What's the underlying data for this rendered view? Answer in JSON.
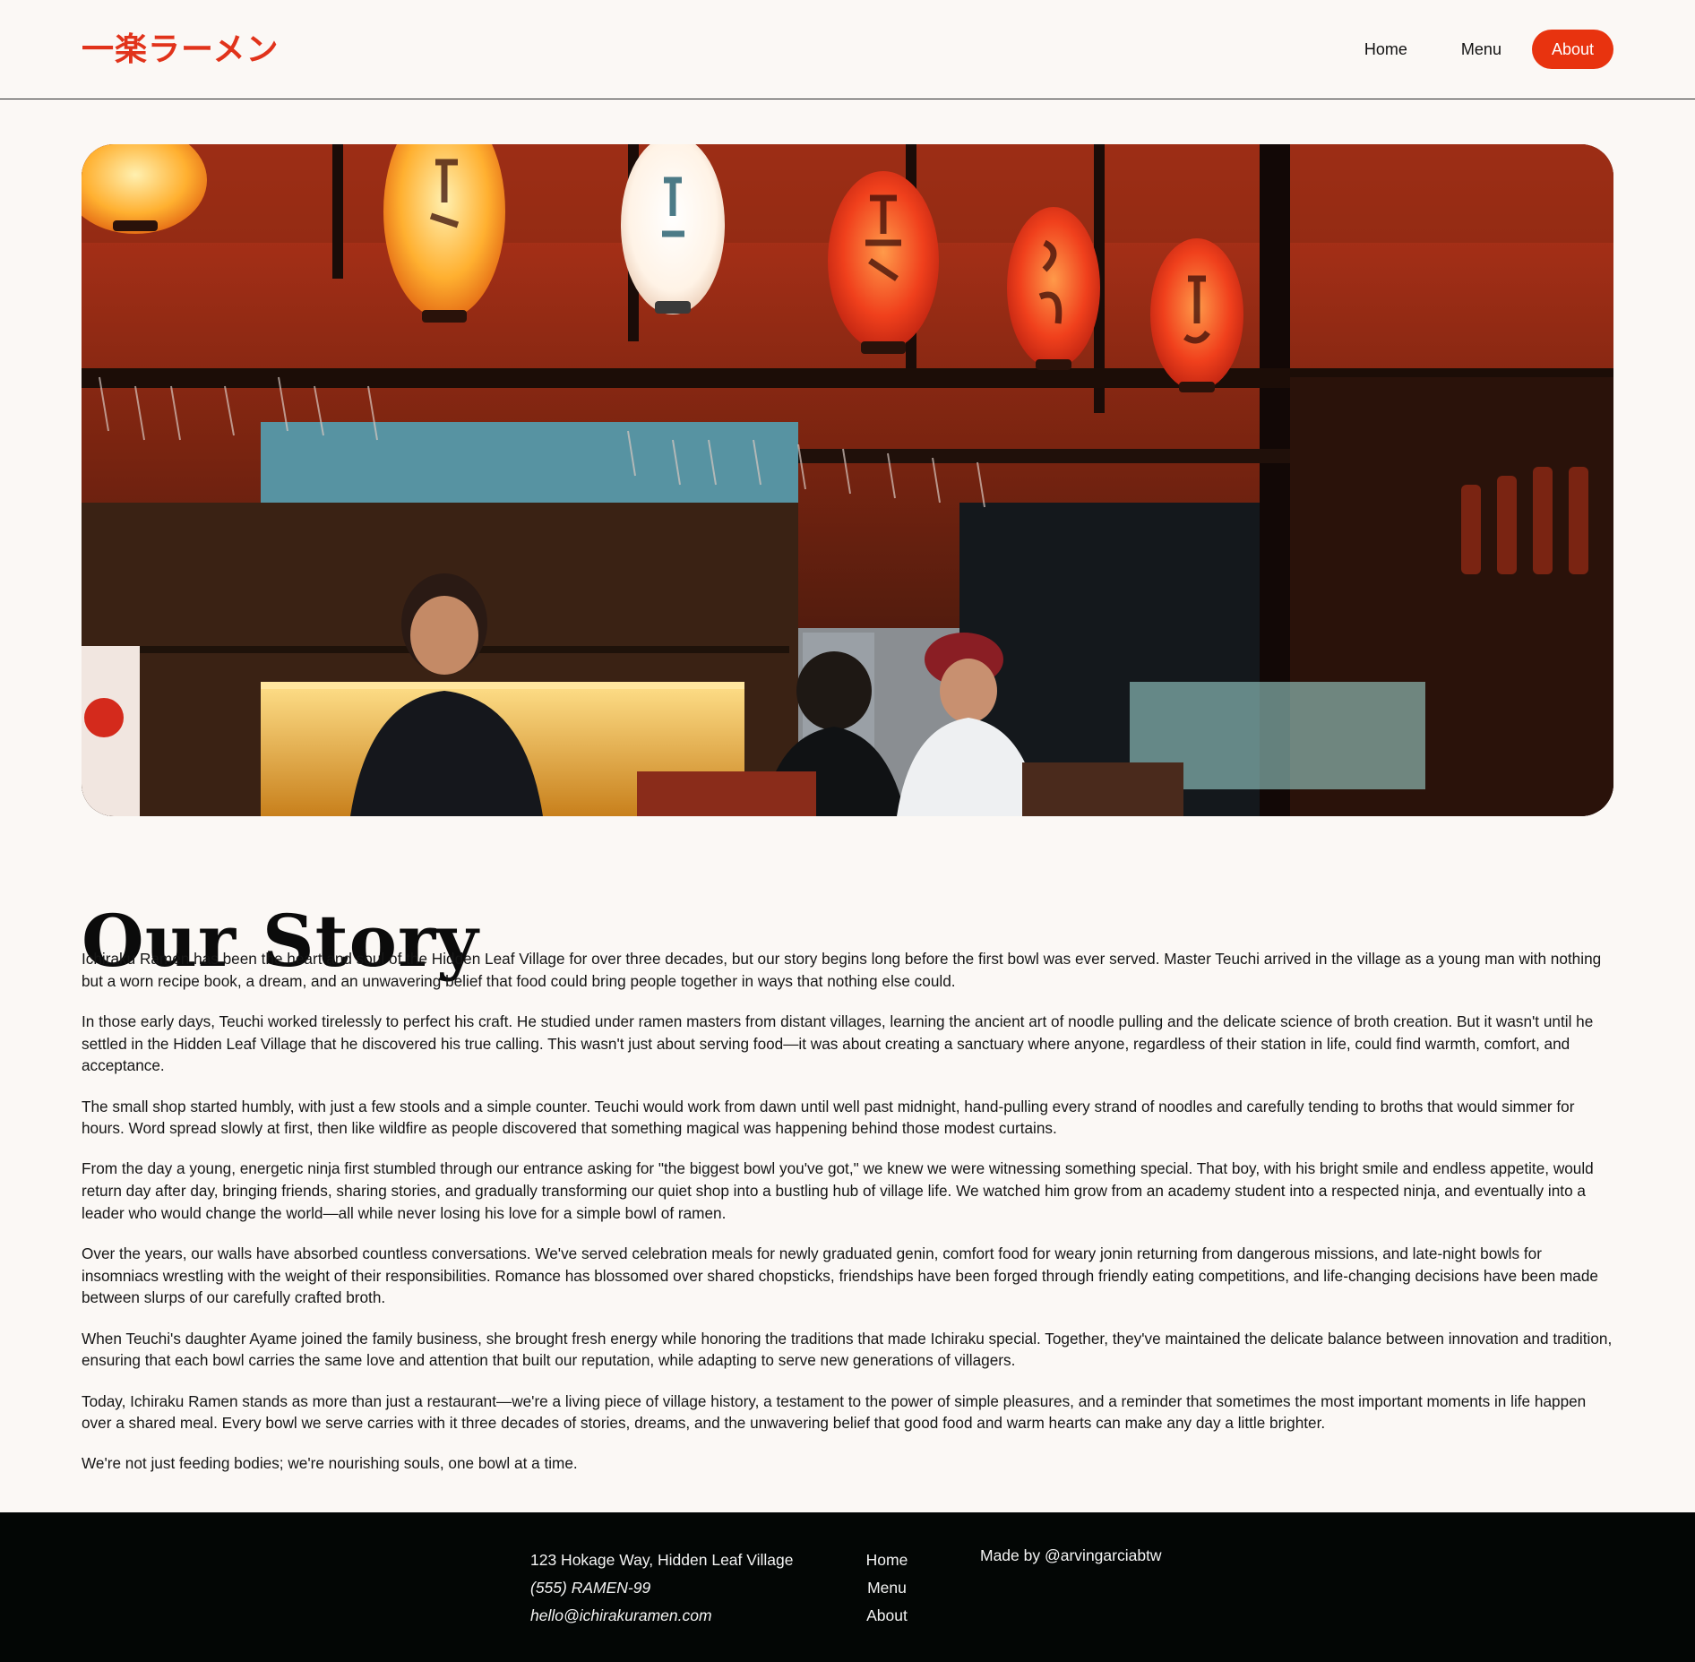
{
  "header": {
    "logo": "一楽ラーメン",
    "nav": [
      {
        "label": "Home",
        "active": false
      },
      {
        "label": "Menu",
        "active": false
      },
      {
        "label": "About",
        "active": true
      }
    ]
  },
  "accent_color": "#e8330f",
  "hero": {
    "icon": "ramen-shop-interior-photo"
  },
  "main": {
    "title": "Our Story",
    "paragraphs": [
      "Ichiraku Ramen has been the heart and soul of the Hidden Leaf Village for over three decades, but our story begins long before the first bowl was ever served. Master Teuchi arrived in the village as a young man with nothing but a worn recipe book, a dream, and an unwavering belief that food could bring people together in ways that nothing else could.",
      "In those early days, Teuchi worked tirelessly to perfect his craft. He studied under ramen masters from distant villages, learning the ancient art of noodle pulling and the delicate science of broth creation. But it wasn't until he settled in the Hidden Leaf Village that he discovered his true calling. This wasn't just about serving food—it was about creating a sanctuary where anyone, regardless of their station in life, could find warmth, comfort, and acceptance.",
      "The small shop started humbly, with just a few stools and a simple counter. Teuchi would work from dawn until well past midnight, hand-pulling every strand of noodles and carefully tending to broths that would simmer for hours. Word spread slowly at first, then like wildfire as people discovered that something magical was happening behind those modest curtains.",
      "From the day a young, energetic ninja first stumbled through our entrance asking for \"the biggest bowl you've got,\" we knew we were witnessing something special. That boy, with his bright smile and endless appetite, would return day after day, bringing friends, sharing stories, and gradually transforming our quiet shop into a bustling hub of village life. We watched him grow from an academy student into a respected ninja, and eventually into a leader who would change the world—all while never losing his love for a simple bowl of ramen.",
      "Over the years, our walls have absorbed countless conversations. We've served celebration meals for newly graduated genin, comfort food for weary jonin returning from dangerous missions, and late-night bowls for insomniacs wrestling with the weight of their responsibilities. Romance has blossomed over shared chopsticks, friendships have been forged through friendly eating competitions, and life-changing decisions have been made between slurps of our carefully crafted broth.",
      "When Teuchi's daughter Ayame joined the family business, she brought fresh energy while honoring the traditions that made Ichiraku special. Together, they've maintained the delicate balance between innovation and tradition, ensuring that each bowl carries the same love and attention that built our reputation, while adapting to serve new generations of villagers.",
      "Today, Ichiraku Ramen stands as more than just a restaurant—we're a living piece of village history, a testament to the power of simple pleasures, and a reminder that sometimes the most important moments in life happen over a shared meal. Every bowl we serve carries with it three decades of stories, dreams, and the unwavering belief that good food and warm hearts can make any day a little brighter.",
      "We're not just feeding bodies; we're nourishing souls, one bowl at a time."
    ]
  },
  "footer": {
    "address": "123 Hokage Way, Hidden Leaf Village",
    "phone": "(555) RAMEN-99",
    "email": "hello@ichirakuramen.com",
    "links": [
      "Home",
      "Menu",
      "About"
    ],
    "credit": "Made by @arvingarciabtw"
  }
}
